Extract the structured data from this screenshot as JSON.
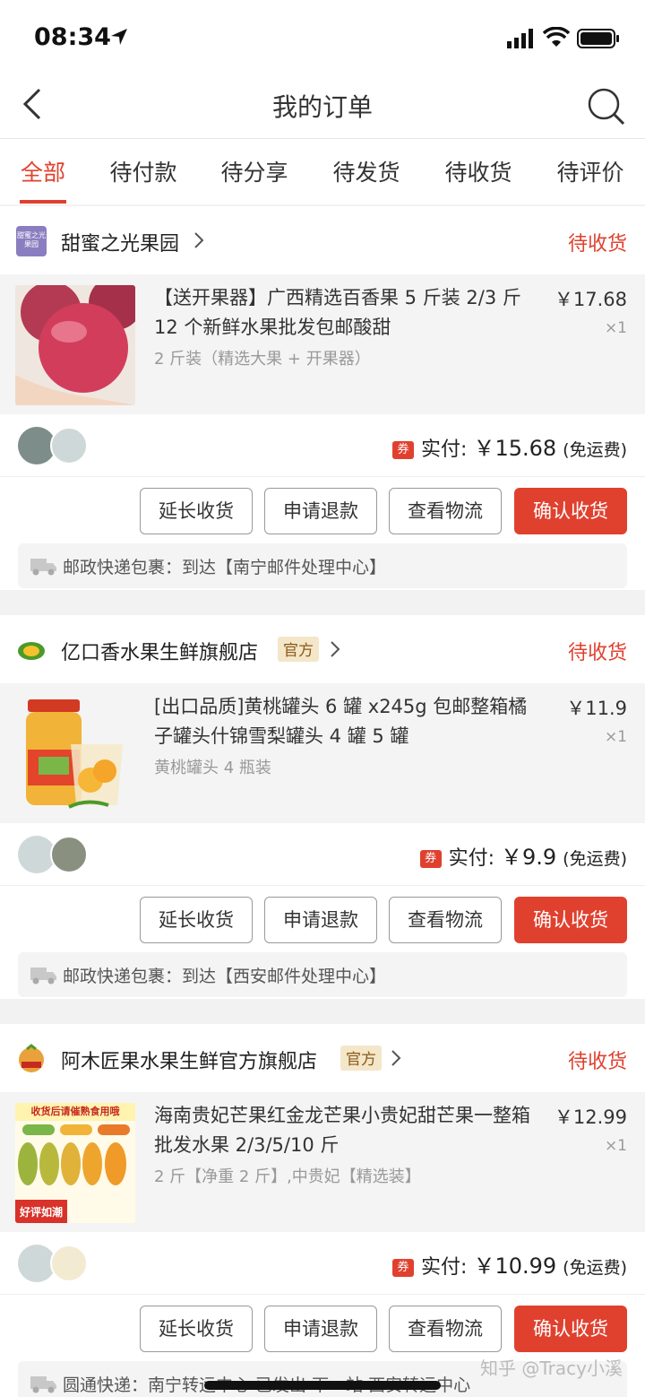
{
  "status_bar": {
    "time": "08:34"
  },
  "nav": {
    "title": "我的订单"
  },
  "tabs": [
    {
      "label": "全部",
      "active": true
    },
    {
      "label": "待付款",
      "active": false
    },
    {
      "label": "待分享",
      "active": false
    },
    {
      "label": "待发货",
      "active": false
    },
    {
      "label": "待收货",
      "active": false
    },
    {
      "label": "待评价",
      "active": false
    }
  ],
  "orders": [
    {
      "shop": "甜蜜之光果园",
      "shop_logo_text": "甜蜜之光果园",
      "official": "",
      "status": "待收货",
      "product_title": "【送开果器】广西精选百香果 5 斤装 2/3 斤 12 个新鲜水果批发包邮酸甜",
      "spec": "2 斤装（精选大果 + 开果器）",
      "price": "￥17.68",
      "qty": "×1",
      "coupon": "券",
      "pay_label": "实付:",
      "pay_amount": "￥15.68",
      "freight": "(免运费)",
      "buttons": [
        "延长收货",
        "申请退款",
        "查看物流",
        "确认收货"
      ],
      "shipping": "邮政快递包裹：到达【南宁邮件处理中心】"
    },
    {
      "shop": "亿口香水果生鲜旗舰店",
      "official": "官方",
      "status": "待收货",
      "product_title": "[出口品质]黄桃罐头 6 罐 x245g 包邮整箱橘子罐头什锦雪梨罐头 4 罐 5 罐",
      "spec": "黄桃罐头 4 瓶装",
      "price": "￥11.9",
      "qty": "×1",
      "coupon": "券",
      "pay_label": "实付:",
      "pay_amount": "￥9.9",
      "freight": "(免运费)",
      "buttons": [
        "延长收货",
        "申请退款",
        "查看物流",
        "确认收货"
      ],
      "shipping": "邮政快递包裹：到达【西安邮件处理中心】"
    },
    {
      "shop": "阿木匠果水果生鲜官方旗舰店",
      "official": "官方",
      "status": "待收货",
      "product_title": "海南贵妃芒果红金龙芒果小贵妃甜芒果一整箱批发水果 2/3/5/10 斤",
      "spec": "2 斤【净重 2 斤】,中贵妃【精选装】",
      "price": "￥12.99",
      "qty": "×1",
      "img_banner": "收货后请催熟食用哦",
      "img_badge": "好评如潮",
      "coupon": "券",
      "pay_label": "实付:",
      "pay_amount": "￥10.99",
      "freight": "(免运费)",
      "buttons": [
        "延长收货",
        "申请退款",
        "查看物流",
        "确认收货"
      ],
      "shipping": "圆通快递：南宁转运中心 已发出 下一站 西安转运中心"
    }
  ],
  "watermark": "知乎 @Tracy小溪",
  "colors": {
    "accent": "#e0412f",
    "official_bg": "#f4e6c8"
  }
}
